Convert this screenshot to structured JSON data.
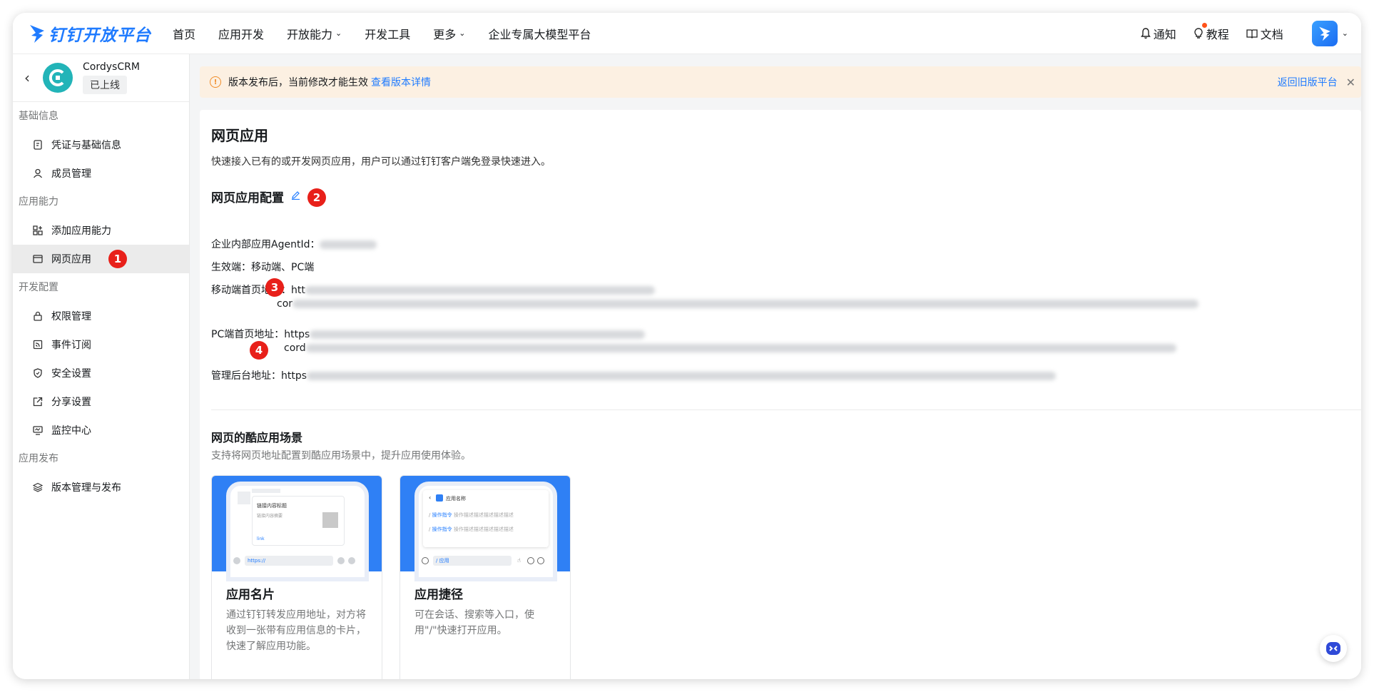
{
  "brand": {
    "name": "钉钉开放平台"
  },
  "nav": {
    "items": [
      {
        "label": "首页"
      },
      {
        "label": "应用开发"
      },
      {
        "label": "开放能力"
      },
      {
        "label": "开发工具"
      },
      {
        "label": "更多"
      },
      {
        "label": "企业专属大模型平台"
      }
    ]
  },
  "topright": {
    "notify": "通知",
    "tutorial": "教程",
    "docs": "文档"
  },
  "app": {
    "name": "CordysCRM",
    "status": "已上线"
  },
  "sidebar": {
    "groups": [
      {
        "label": "基础信息",
        "items": [
          {
            "label": "凭证与基础信息"
          },
          {
            "label": "成员管理"
          }
        ]
      },
      {
        "label": "应用能力",
        "items": [
          {
            "label": "添加应用能力"
          },
          {
            "label": "网页应用"
          }
        ]
      },
      {
        "label": "开发配置",
        "items": [
          {
            "label": "权限管理"
          },
          {
            "label": "事件订阅"
          },
          {
            "label": "安全设置"
          },
          {
            "label": "分享设置"
          },
          {
            "label": "监控中心"
          }
        ]
      },
      {
        "label": "应用发布",
        "items": [
          {
            "label": "版本管理与发布"
          }
        ]
      }
    ],
    "active_badge": "1"
  },
  "notice": {
    "text": "版本发布后，当前修改才能生效",
    "link": "查看版本详情",
    "right_link": "返回旧版平台"
  },
  "main": {
    "title": "网页应用",
    "desc": "快速接入已有的或开发网页应用，用户可以通过钉钉客户端免登录快速进入。",
    "config_title": "网页应用配置",
    "config_badge": "2",
    "agentid_label": "企业内部应用AgentId：",
    "platform_label": "生效端：移动端、PC端",
    "mobile_label": "移动端首页地址：",
    "mobile_badge": "3",
    "mobile_prefix1": "htt",
    "mobile_prefix2": "cor",
    "pc_label": "PC端首页地址：",
    "pc_badge": "4",
    "pc_prefix1": "https",
    "pc_prefix2": "cord",
    "admin_label": "管理后台地址：",
    "admin_prefix": "https",
    "scenes_title": "网页的酷应用场景",
    "scenes_sub": "支持将网页地址配置到酷应用场景中，提升应用使用体验。",
    "scenes": [
      {
        "title": "应用名片",
        "desc": "通过钉钉转发应用地址，对方将收到一张带有应用信息的卡片，快速了解应用功能。",
        "mock_title": "链接内容标题",
        "mock_sub": "链接内容摘要",
        "mock_link": "link",
        "mock_input": "https://"
      },
      {
        "title": "应用捷径",
        "desc": "可在会话、搜索等入口，使用\"/\"快速打开应用。",
        "mock_title": "应用名称",
        "mock_cmd1": "操作指令",
        "mock_cmd2": "操作指令",
        "mock_cmd_desc": "操作描述描述描述描述描述",
        "mock_input": "/ 应用"
      }
    ]
  },
  "colors": {
    "accent": "#1f7bff",
    "badge": "#e8201a",
    "notice_bg": "#fcf0e2"
  }
}
